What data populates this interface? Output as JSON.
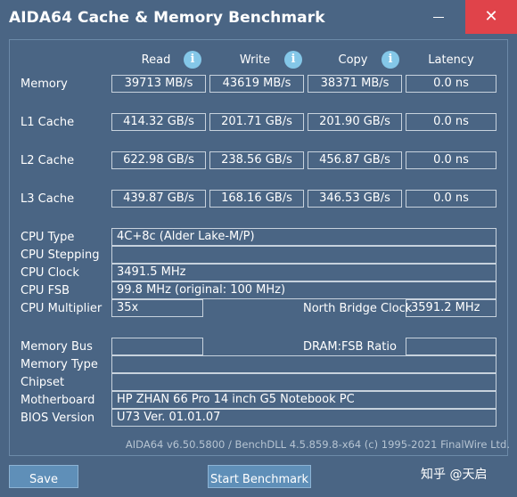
{
  "window": {
    "title": "AIDA64 Cache & Memory Benchmark",
    "minimize_icon": "minimize-icon",
    "close_glyph": "✕"
  },
  "columns": {
    "read": "Read",
    "write": "Write",
    "copy": "Copy",
    "latency": "Latency",
    "info_glyph": "i"
  },
  "rows": [
    {
      "label": "Memory",
      "read": "39713 MB/s",
      "write": "43619 MB/s",
      "copy": "38371 MB/s",
      "latency": "0.0 ns"
    },
    {
      "label": "L1 Cache",
      "read": "414.32 GB/s",
      "write": "201.71 GB/s",
      "copy": "201.90 GB/s",
      "latency": "0.0 ns"
    },
    {
      "label": "L2 Cache",
      "read": "622.98 GB/s",
      "write": "238.56 GB/s",
      "copy": "456.87 GB/s",
      "latency": "0.0 ns"
    },
    {
      "label": "L3 Cache",
      "read": "439.87 GB/s",
      "write": "168.16 GB/s",
      "copy": "346.53 GB/s",
      "latency": "0.0 ns"
    }
  ],
  "cpu": {
    "type_label": "CPU Type",
    "type_value": "4C+8c   (Alder Lake-M/P)",
    "stepping_label": "CPU Stepping",
    "stepping_value": "",
    "clock_label": "CPU Clock",
    "clock_value": "3491.5 MHz",
    "fsb_label": "CPU FSB",
    "fsb_value": "99.8 MHz  (original: 100 MHz)",
    "multiplier_label": "CPU Multiplier",
    "multiplier_value": "35x",
    "nb_clock_label": "North Bridge Clock",
    "nb_clock_value": "3591.2 MHz"
  },
  "system": {
    "bus_label": "Memory Bus",
    "bus_value": "",
    "dram_ratio_label": "DRAM:FSB Ratio",
    "dram_ratio_value": "",
    "type_label": "Memory Type",
    "type_value": "",
    "chipset_label": "Chipset",
    "chipset_value": "",
    "motherboard_label": "Motherboard",
    "motherboard_value": "HP ZHAN 66 Pro 14 inch G5 Notebook PC",
    "bios_label": "BIOS Version",
    "bios_value": "U73 Ver. 01.01.07"
  },
  "footer": "AIDA64 v6.50.5800 / BenchDLL 4.5.859.8-x64  (c) 1995-2021 FinalWire Ltd.",
  "buttons": {
    "save": "Save",
    "start": "Start Benchmark"
  },
  "watermark": "知乎 @天启",
  "colors": {
    "background": "#4a6584",
    "close": "#e0434a",
    "button": "#5f8fb8",
    "info": "#84c7e8"
  }
}
